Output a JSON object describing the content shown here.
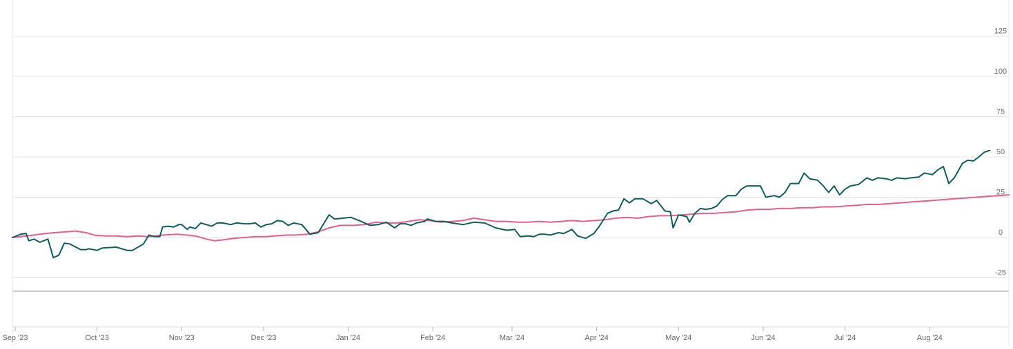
{
  "chart_data": {
    "type": "line",
    "title": "",
    "xlabel": "",
    "ylabel": "",
    "x_range": [
      "2023-08-31",
      "2024-08-30"
    ],
    "ylim": [
      -25,
      125
    ],
    "y_ticks": [
      "125",
      "100",
      "75",
      "50",
      "25",
      "0",
      "-25"
    ],
    "y_tick_values": [
      125,
      100,
      75,
      50,
      25,
      0,
      -25
    ],
    "y_axis_side": "right",
    "x_ticks": [
      {
        "label": "Sep '23",
        "date": "2023-09-01"
      },
      {
        "label": "Oct '23",
        "date": "2023-10-01"
      },
      {
        "label": "Nov '23",
        "date": "2023-11-01"
      },
      {
        "label": "Dec '23",
        "date": "2023-12-01"
      },
      {
        "label": "Jan '24",
        "date": "2024-01-01"
      },
      {
        "label": "Feb '24",
        "date": "2024-02-01"
      },
      {
        "label": "Mar '24",
        "date": "2024-03-01"
      },
      {
        "label": "Apr '24",
        "date": "2024-04-01"
      },
      {
        "label": "May '24",
        "date": "2024-05-01"
      },
      {
        "label": "Jun '24",
        "date": "2024-06-01"
      },
      {
        "label": "Jul '24",
        "date": "2024-07-01"
      },
      {
        "label": "Aug '24",
        "date": "2024-08-01"
      }
    ],
    "grid": true,
    "legend": "none",
    "series": [
      {
        "color": "#0f5c5c",
        "points": [
          [
            "2023-08-31",
            0
          ],
          [
            "2023-09-03",
            2
          ],
          [
            "2023-09-05",
            2.5
          ],
          [
            "2023-09-06",
            -2
          ],
          [
            "2023-09-08",
            -1
          ],
          [
            "2023-09-10",
            -3
          ],
          [
            "2023-09-13",
            -1
          ],
          [
            "2023-09-15",
            -12.5
          ],
          [
            "2023-09-17",
            -11
          ],
          [
            "2023-09-19",
            -3.5
          ],
          [
            "2023-09-21",
            -4
          ],
          [
            "2023-09-25",
            -7.5
          ],
          [
            "2023-09-27",
            -7.5
          ],
          [
            "2023-09-28",
            -7
          ],
          [
            "2023-10-01",
            -8
          ],
          [
            "2023-10-03",
            -6.5
          ],
          [
            "2023-10-08",
            -6
          ],
          [
            "2023-10-12",
            -8
          ],
          [
            "2023-10-14",
            -8
          ],
          [
            "2023-10-18",
            -4
          ],
          [
            "2023-10-20",
            1.5
          ],
          [
            "2023-10-22",
            0.5
          ],
          [
            "2023-10-24",
            0.5
          ],
          [
            "2023-10-25",
            6.5
          ],
          [
            "2023-10-27",
            7
          ],
          [
            "2023-10-29",
            6.5
          ],
          [
            "2023-10-31",
            8
          ],
          [
            "2023-11-01",
            8
          ],
          [
            "2023-11-03",
            5
          ],
          [
            "2023-11-04",
            6.5
          ],
          [
            "2023-11-06",
            5.5
          ],
          [
            "2023-11-08",
            9
          ],
          [
            "2023-11-10",
            8
          ],
          [
            "2023-11-12",
            7
          ],
          [
            "2023-11-14",
            9
          ],
          [
            "2023-11-16",
            9
          ],
          [
            "2023-11-19",
            8
          ],
          [
            "2023-11-21",
            9
          ],
          [
            "2023-11-24",
            8.5
          ],
          [
            "2023-11-26",
            8.5
          ],
          [
            "2023-11-28",
            9
          ],
          [
            "2023-11-30",
            6.5
          ],
          [
            "2023-12-02",
            8
          ],
          [
            "2023-12-04",
            8.5
          ],
          [
            "2023-12-06",
            10.5
          ],
          [
            "2023-12-08",
            10
          ],
          [
            "2023-12-10",
            7.5
          ],
          [
            "2023-12-12",
            9
          ],
          [
            "2023-12-15",
            8
          ],
          [
            "2023-12-18",
            2
          ],
          [
            "2023-12-21",
            3
          ],
          [
            "2023-12-25",
            14
          ],
          [
            "2023-12-27",
            11.5
          ],
          [
            "2024-01-02",
            12.5
          ],
          [
            "2024-01-05",
            10.5
          ],
          [
            "2024-01-09",
            7.5
          ],
          [
            "2024-01-12",
            8
          ],
          [
            "2024-01-15",
            9.5
          ],
          [
            "2024-01-18",
            6
          ],
          [
            "2024-01-20",
            8.5
          ],
          [
            "2024-01-22",
            8.5
          ],
          [
            "2024-01-24",
            7.5
          ],
          [
            "2024-01-26",
            9
          ],
          [
            "2024-01-29",
            10
          ],
          [
            "2024-01-30",
            11.5
          ],
          [
            "2024-02-02",
            10
          ],
          [
            "2024-02-05",
            10
          ],
          [
            "2024-02-08",
            9
          ],
          [
            "2024-02-12",
            8
          ],
          [
            "2024-02-16",
            9.5
          ],
          [
            "2024-02-20",
            9
          ],
          [
            "2024-02-24",
            6
          ],
          [
            "2024-02-28",
            4.5
          ],
          [
            "2024-03-02",
            5
          ],
          [
            "2024-03-04",
            0.5
          ],
          [
            "2024-03-07",
            1
          ],
          [
            "2024-03-09",
            0.5
          ],
          [
            "2024-03-11",
            2
          ],
          [
            "2024-03-13",
            2
          ],
          [
            "2024-03-15",
            1.5
          ],
          [
            "2024-03-18",
            3
          ],
          [
            "2024-03-20",
            2.5
          ],
          [
            "2024-03-23",
            5
          ],
          [
            "2024-03-25",
            1
          ],
          [
            "2024-03-28",
            -0.5
          ],
          [
            "2024-03-31",
            2.5
          ],
          [
            "2024-04-02",
            7
          ],
          [
            "2024-04-05",
            15
          ],
          [
            "2024-04-07",
            16.5
          ],
          [
            "2024-04-09",
            17
          ],
          [
            "2024-04-11",
            24
          ],
          [
            "2024-04-13",
            21.5
          ],
          [
            "2024-04-15",
            24
          ],
          [
            "2024-04-18",
            24
          ],
          [
            "2024-04-21",
            21
          ],
          [
            "2024-04-23",
            23
          ],
          [
            "2024-04-26",
            16.5
          ],
          [
            "2024-04-28",
            16
          ],
          [
            "2024-04-29",
            6
          ],
          [
            "2024-05-01",
            14
          ],
          [
            "2024-05-04",
            13
          ],
          [
            "2024-05-05",
            9.5
          ],
          [
            "2024-05-07",
            15
          ],
          [
            "2024-05-09",
            18
          ],
          [
            "2024-05-11",
            17.5
          ],
          [
            "2024-05-13",
            18
          ],
          [
            "2024-05-15",
            19.5
          ],
          [
            "2024-05-17",
            23.5
          ],
          [
            "2024-05-19",
            26
          ],
          [
            "2024-05-22",
            26
          ],
          [
            "2024-05-24",
            30
          ],
          [
            "2024-05-26",
            32
          ],
          [
            "2024-05-29",
            32
          ],
          [
            "2024-05-31",
            32
          ],
          [
            "2024-06-02",
            25
          ],
          [
            "2024-06-05",
            26
          ],
          [
            "2024-06-07",
            25
          ],
          [
            "2024-06-09",
            28
          ],
          [
            "2024-06-11",
            33.5
          ],
          [
            "2024-06-14",
            33.5
          ],
          [
            "2024-06-16",
            40
          ],
          [
            "2024-06-18",
            36.5
          ],
          [
            "2024-06-21",
            35.5
          ],
          [
            "2024-06-23",
            32
          ],
          [
            "2024-06-25",
            28
          ],
          [
            "2024-06-27",
            32
          ],
          [
            "2024-06-29",
            26.5
          ],
          [
            "2024-07-01",
            30
          ],
          [
            "2024-07-03",
            32
          ],
          [
            "2024-07-06",
            33
          ],
          [
            "2024-07-09",
            37
          ],
          [
            "2024-07-11",
            35.5
          ],
          [
            "2024-07-13",
            37
          ],
          [
            "2024-07-16",
            36.5
          ],
          [
            "2024-07-18",
            35.5
          ],
          [
            "2024-07-20",
            37
          ],
          [
            "2024-07-23",
            36.5
          ],
          [
            "2024-07-25",
            37
          ],
          [
            "2024-07-28",
            37.5
          ],
          [
            "2024-07-30",
            40
          ],
          [
            "2024-08-02",
            39
          ],
          [
            "2024-08-04",
            42
          ],
          [
            "2024-08-06",
            44
          ],
          [
            "2024-08-08",
            33.5
          ],
          [
            "2024-08-10",
            37
          ],
          [
            "2024-08-13",
            46
          ],
          [
            "2024-08-15",
            48
          ],
          [
            "2024-08-17",
            47.5
          ],
          [
            "2024-08-19",
            50
          ],
          [
            "2024-08-21",
            53
          ],
          [
            "2024-08-23",
            54
          ]
        ]
      },
      {
        "color": "#e85d8f",
        "points": [
          [
            "2023-08-31",
            0
          ],
          [
            "2023-09-05",
            1
          ],
          [
            "2023-09-10",
            2
          ],
          [
            "2023-09-15",
            3
          ],
          [
            "2023-09-20",
            3.5
          ],
          [
            "2023-09-23",
            4
          ],
          [
            "2023-09-27",
            3
          ],
          [
            "2023-09-30",
            1.5
          ],
          [
            "2023-10-04",
            1
          ],
          [
            "2023-10-08",
            1
          ],
          [
            "2023-10-12",
            0.5
          ],
          [
            "2023-10-16",
            1
          ],
          [
            "2023-10-20",
            0.5
          ],
          [
            "2023-10-25",
            1.5
          ],
          [
            "2023-10-30",
            2
          ],
          [
            "2023-11-03",
            1.5
          ],
          [
            "2023-11-06",
            1
          ],
          [
            "2023-11-10",
            -1
          ],
          [
            "2023-11-13",
            -2
          ],
          [
            "2023-11-16",
            -1.5
          ],
          [
            "2023-11-20",
            -0.5
          ],
          [
            "2023-11-24",
            0
          ],
          [
            "2023-11-28",
            0.5
          ],
          [
            "2023-12-02",
            0.5
          ],
          [
            "2023-12-05",
            1
          ],
          [
            "2023-12-09",
            1.5
          ],
          [
            "2023-12-13",
            1.5
          ],
          [
            "2023-12-17",
            2
          ],
          [
            "2023-12-21",
            3.5
          ],
          [
            "2023-12-25",
            6
          ],
          [
            "2023-12-29",
            7.5
          ],
          [
            "2024-01-03",
            7.5
          ],
          [
            "2024-01-07",
            8
          ],
          [
            "2024-01-11",
            9.5
          ],
          [
            "2024-01-15",
            9
          ],
          [
            "2024-01-19",
            9
          ],
          [
            "2024-01-23",
            10
          ],
          [
            "2024-01-27",
            11
          ],
          [
            "2024-01-31",
            10.5
          ],
          [
            "2024-02-04",
            9.5
          ],
          [
            "2024-02-08",
            10
          ],
          [
            "2024-02-12",
            10.5
          ],
          [
            "2024-02-16",
            12
          ],
          [
            "2024-02-20",
            11
          ],
          [
            "2024-02-24",
            10
          ],
          [
            "2024-02-28",
            10
          ],
          [
            "2024-03-03",
            9.5
          ],
          [
            "2024-03-07",
            9.5
          ],
          [
            "2024-03-11",
            10
          ],
          [
            "2024-03-15",
            9.5
          ],
          [
            "2024-03-19",
            10
          ],
          [
            "2024-03-23",
            10.5
          ],
          [
            "2024-03-27",
            10
          ],
          [
            "2024-03-31",
            10.5
          ],
          [
            "2024-04-04",
            11
          ],
          [
            "2024-04-08",
            12
          ],
          [
            "2024-04-12",
            12.5
          ],
          [
            "2024-04-16",
            12
          ],
          [
            "2024-04-20",
            13
          ],
          [
            "2024-04-24",
            13.5
          ],
          [
            "2024-04-28",
            13.5
          ],
          [
            "2024-05-02",
            14
          ],
          [
            "2024-05-06",
            14.5
          ],
          [
            "2024-05-10",
            15
          ],
          [
            "2024-05-14",
            15
          ],
          [
            "2024-05-18",
            15.5
          ],
          [
            "2024-05-22",
            16
          ],
          [
            "2024-05-26",
            17
          ],
          [
            "2024-05-30",
            17.5
          ],
          [
            "2024-06-03",
            17.5
          ],
          [
            "2024-06-07",
            18
          ],
          [
            "2024-06-11",
            18
          ],
          [
            "2024-06-15",
            18.5
          ],
          [
            "2024-06-19",
            18.5
          ],
          [
            "2024-06-23",
            19
          ],
          [
            "2024-06-27",
            19
          ],
          [
            "2024-07-01",
            19.5
          ],
          [
            "2024-07-05",
            20
          ],
          [
            "2024-07-09",
            20.5
          ],
          [
            "2024-07-13",
            20.5
          ],
          [
            "2024-07-17",
            21
          ],
          [
            "2024-07-21",
            21.5
          ],
          [
            "2024-07-25",
            22
          ],
          [
            "2024-07-29",
            22.5
          ],
          [
            "2024-08-02",
            23
          ],
          [
            "2024-08-06",
            23.5
          ],
          [
            "2024-08-10",
            24
          ],
          [
            "2024-08-14",
            24.5
          ],
          [
            "2024-08-18",
            25
          ],
          [
            "2024-08-22",
            25.5
          ],
          [
            "2024-08-26",
            26
          ],
          [
            "2024-08-30",
            26.5
          ]
        ]
      }
    ]
  }
}
